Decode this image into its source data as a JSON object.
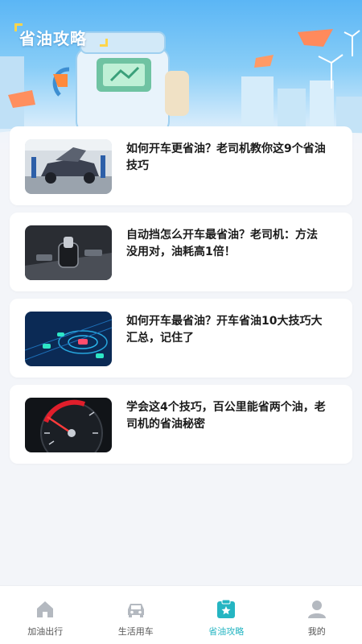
{
  "banner": {
    "title": "省油攻略"
  },
  "articles": [
    {
      "title": "如何开车更省油？老司机教你这9个省油技巧",
      "thumb": "car-garage-image"
    },
    {
      "title": "自动挡怎么开车最省油？老司机：方法没用对，油耗高1倍！",
      "thumb": "gear-shifter-image"
    },
    {
      "title": "如何开车最省油？开车省油10大技巧大汇总，记住了",
      "thumb": "traffic-radar-image"
    },
    {
      "title": "学会这4个技巧，百公里能省两个油，老司机的省油秘密",
      "thumb": "speedometer-image"
    }
  ],
  "nav": [
    {
      "label": "加油出行",
      "icon": "home-icon",
      "active": false
    },
    {
      "label": "生活用车",
      "icon": "car-icon",
      "active": false
    },
    {
      "label": "省油攻略",
      "icon": "guide-icon",
      "active": true
    },
    {
      "label": "我的",
      "icon": "user-icon",
      "active": false
    }
  ],
  "colors": {
    "accent": "#25b5c2",
    "nav_inactive": "#b4b9c0",
    "header_top": "#5bb6f5",
    "page_bg": "#f3f5f9"
  }
}
